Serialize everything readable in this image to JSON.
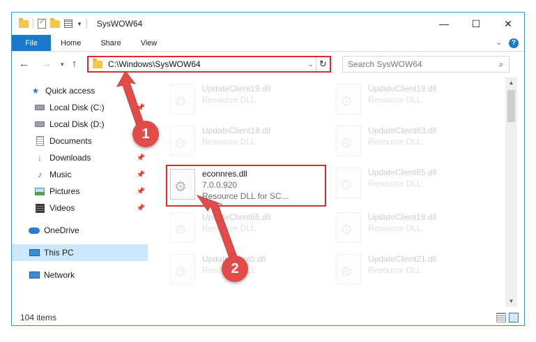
{
  "window": {
    "title": "SysWOW64",
    "controls": {
      "minimize": "—",
      "maximize": "☐",
      "close": "✕"
    }
  },
  "ribbon": {
    "file_tab": "File",
    "tabs": [
      "Home",
      "Share",
      "View"
    ]
  },
  "address_bar": {
    "path": "C:\\Windows\\SysWOW64",
    "search_placeholder": "Search SysWOW64"
  },
  "nav_pane": {
    "items": [
      {
        "label": "Quick access",
        "icon": "star-icon",
        "pinned": false
      },
      {
        "label": "Local Disk (C:)",
        "icon": "disk-icon",
        "pinned": true
      },
      {
        "label": "Local Disk (D:)",
        "icon": "disk-icon",
        "pinned": false
      },
      {
        "label": "Documents",
        "icon": "documents-icon",
        "pinned": true
      },
      {
        "label": "Downloads",
        "icon": "downloads-icon",
        "pinned": true
      },
      {
        "label": "Music",
        "icon": "music-icon",
        "pinned": true
      },
      {
        "label": "Pictures",
        "icon": "pictures-icon",
        "pinned": true
      },
      {
        "label": "Videos",
        "icon": "videos-icon",
        "pinned": true
      },
      {
        "label": "OneDrive",
        "icon": "onedrive-icon",
        "pinned": false
      },
      {
        "label": "This PC",
        "icon": "this-pc-icon",
        "pinned": false,
        "selected": true
      },
      {
        "label": "Network",
        "icon": "network-icon",
        "pinned": false
      }
    ]
  },
  "files": [
    {
      "name": "UpdateClient19.dll",
      "line2": "Resource DLL",
      "line3": ""
    },
    {
      "name": "UpdateClient19.dll",
      "line2": "Resource DLL",
      "line3": ""
    },
    {
      "name": "UpdateClient19.dll",
      "line2": "Resource DLL",
      "line3": ""
    },
    {
      "name": "UpdateClient63.dll",
      "line2": "Resource DLL",
      "line3": ""
    },
    {
      "name": "econnres.dll",
      "line2": "7.0.0.920",
      "line3": "Resource DLL for SC..."
    },
    {
      "name": "UpdateClient65.dll",
      "line2": "Resource DLL",
      "line3": ""
    },
    {
      "name": "UpdateClient65.dll",
      "line2": "Resource DLL",
      "line3": ""
    },
    {
      "name": "UpdateClient19.dll",
      "line2": "Resource DLL",
      "line3": ""
    },
    {
      "name": "UpdateClient5.dll",
      "line2": "Resource DLL",
      "line3": ""
    },
    {
      "name": "UpdateClient21.dll",
      "line2": "Resource DLL",
      "line3": ""
    }
  ],
  "status": {
    "item_count": "104 items"
  },
  "annotations": {
    "step1": "1",
    "step2": "2",
    "color": "#e24c48"
  }
}
